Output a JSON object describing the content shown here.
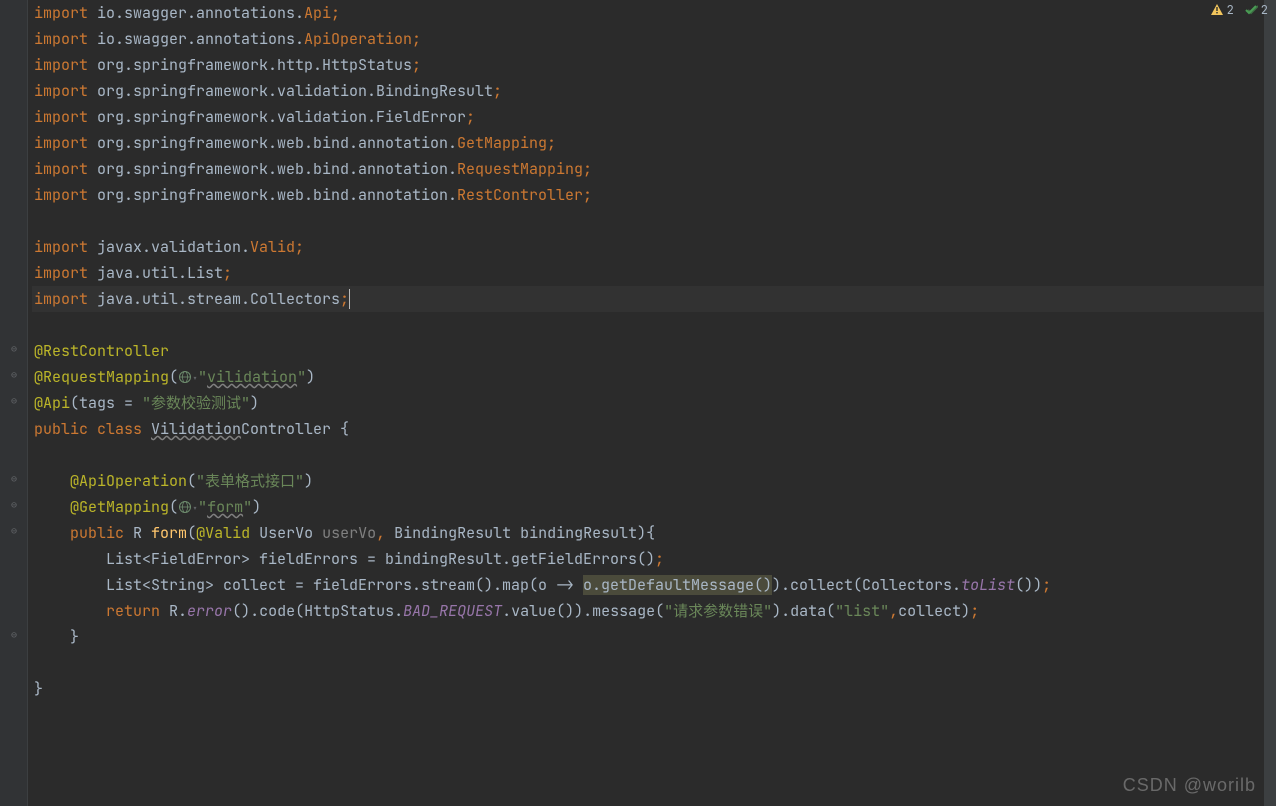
{
  "indicators": {
    "warning_count": "2",
    "check_count": "2"
  },
  "watermark": "CSDN @worilb",
  "code": {
    "lines": [
      {
        "type": "import",
        "parts": [
          {
            "k": "kw",
            "t": "import "
          },
          {
            "k": "p",
            "t": "io.swagger.annotations."
          },
          {
            "k": "cls",
            "t": "Api"
          },
          {
            "k": "semi",
            "t": ";"
          }
        ]
      },
      {
        "type": "import",
        "parts": [
          {
            "k": "kw",
            "t": "import "
          },
          {
            "k": "p",
            "t": "io.swagger.annotations."
          },
          {
            "k": "cls",
            "t": "ApiOperation"
          },
          {
            "k": "semi",
            "t": ";"
          }
        ]
      },
      {
        "type": "import",
        "parts": [
          {
            "k": "kw",
            "t": "import "
          },
          {
            "k": "p",
            "t": "org.springframework.http.HttpStatus"
          },
          {
            "k": "semi",
            "t": ";"
          }
        ]
      },
      {
        "type": "import",
        "parts": [
          {
            "k": "kw",
            "t": "import "
          },
          {
            "k": "p",
            "t": "org.springframework.validation.BindingResult"
          },
          {
            "k": "semi",
            "t": ";"
          }
        ]
      },
      {
        "type": "import",
        "parts": [
          {
            "k": "kw",
            "t": "import "
          },
          {
            "k": "p",
            "t": "org.springframework.validation.FieldError"
          },
          {
            "k": "semi",
            "t": ";"
          }
        ]
      },
      {
        "type": "import",
        "parts": [
          {
            "k": "kw",
            "t": "import "
          },
          {
            "k": "p",
            "t": "org.springframework.web.bind.annotation."
          },
          {
            "k": "cls",
            "t": "GetMapping"
          },
          {
            "k": "semi",
            "t": ";"
          }
        ]
      },
      {
        "type": "import",
        "parts": [
          {
            "k": "kw",
            "t": "import "
          },
          {
            "k": "p",
            "t": "org.springframework.web.bind.annotation."
          },
          {
            "k": "cls",
            "t": "RequestMapping"
          },
          {
            "k": "semi",
            "t": ";"
          }
        ]
      },
      {
        "type": "import",
        "parts": [
          {
            "k": "kw",
            "t": "import "
          },
          {
            "k": "p",
            "t": "org.springframework.web.bind.annotation."
          },
          {
            "k": "cls",
            "t": "RestController"
          },
          {
            "k": "semi",
            "t": ";"
          }
        ]
      },
      {
        "type": "blank"
      },
      {
        "type": "import",
        "parts": [
          {
            "k": "kw",
            "t": "import "
          },
          {
            "k": "p",
            "t": "javax.validation."
          },
          {
            "k": "cls",
            "t": "Valid"
          },
          {
            "k": "semi",
            "t": ";"
          }
        ]
      },
      {
        "type": "import",
        "parts": [
          {
            "k": "kw",
            "t": "import "
          },
          {
            "k": "p",
            "t": "java.util.List"
          },
          {
            "k": "semi",
            "t": ";"
          }
        ]
      },
      {
        "type": "import",
        "highlighted": true,
        "parts": [
          {
            "k": "kw",
            "t": "import "
          },
          {
            "k": "p",
            "t": "java.util.stream.Collectors"
          },
          {
            "k": "semi",
            "t": ";"
          },
          {
            "k": "cursor",
            "t": ""
          }
        ]
      },
      {
        "type": "blank"
      },
      {
        "type": "anno",
        "parts": [
          {
            "k": "ann",
            "t": "@RestController"
          }
        ]
      },
      {
        "type": "anno",
        "parts": [
          {
            "k": "ann",
            "t": "@RequestMapping"
          },
          {
            "k": "p",
            "t": "("
          },
          {
            "k": "globe",
            "t": ""
          },
          {
            "k": "str",
            "t": "\""
          },
          {
            "k": "strwarn",
            "t": "vilidation"
          },
          {
            "k": "str",
            "t": "\""
          },
          {
            "k": "p",
            "t": ")"
          }
        ]
      },
      {
        "type": "anno",
        "parts": [
          {
            "k": "ann",
            "t": "@Api"
          },
          {
            "k": "p",
            "t": "(tags = "
          },
          {
            "k": "str",
            "t": "\"参数校验测试\""
          },
          {
            "k": "p",
            "t": ")"
          }
        ]
      },
      {
        "type": "classdef",
        "parts": [
          {
            "k": "kw",
            "t": "public class "
          },
          {
            "k": "warn",
            "t": "Vilidation"
          },
          {
            "k": "p",
            "t": "Controller {"
          }
        ]
      },
      {
        "type": "blank"
      },
      {
        "type": "anno",
        "indent": 1,
        "parts": [
          {
            "k": "ann",
            "t": "@ApiOperation"
          },
          {
            "k": "p",
            "t": "("
          },
          {
            "k": "str",
            "t": "\"表单格式接口\""
          },
          {
            "k": "p",
            "t": ")"
          }
        ]
      },
      {
        "type": "anno",
        "indent": 1,
        "parts": [
          {
            "k": "ann",
            "t": "@GetMapping"
          },
          {
            "k": "p",
            "t": "("
          },
          {
            "k": "globe",
            "t": ""
          },
          {
            "k": "str",
            "t": "\""
          },
          {
            "k": "strwarn",
            "t": "form"
          },
          {
            "k": "str",
            "t": "\""
          },
          {
            "k": "p",
            "t": ")"
          }
        ]
      },
      {
        "type": "method",
        "indent": 1,
        "parts": [
          {
            "k": "kw",
            "t": "public "
          },
          {
            "k": "p",
            "t": "R "
          },
          {
            "k": "fn",
            "t": "form"
          },
          {
            "k": "p",
            "t": "("
          },
          {
            "k": "ann",
            "t": "@Valid "
          },
          {
            "k": "p",
            "t": "UserVo "
          },
          {
            "k": "var",
            "t": "userVo"
          },
          {
            "k": "semi",
            "t": ", "
          },
          {
            "k": "p",
            "t": "BindingResult bindingResult){"
          }
        ]
      },
      {
        "type": "body",
        "indent": 2,
        "parts": [
          {
            "k": "p",
            "t": "List<FieldError> fieldErrors = bindingResult.getFieldErrors()"
          },
          {
            "k": "semi",
            "t": ";"
          }
        ]
      },
      {
        "type": "body",
        "indent": 2,
        "parts": [
          {
            "k": "p",
            "t": "List<String> collect = fieldErrors.stream().map(o -> "
          },
          {
            "k": "hl",
            "t": "o.getDefaultMessage()"
          },
          {
            "k": "p",
            "t": ").collect(Collectors."
          },
          {
            "k": "ital",
            "t": "toList"
          },
          {
            "k": "p",
            "t": "())"
          },
          {
            "k": "semi",
            "t": ";"
          }
        ]
      },
      {
        "type": "return",
        "indent": 2,
        "parts": [
          {
            "k": "kw",
            "t": "return "
          },
          {
            "k": "p",
            "t": "R."
          },
          {
            "k": "ital",
            "t": "error"
          },
          {
            "k": "p",
            "t": "().code(HttpStatus."
          },
          {
            "k": "ital",
            "t": "BAD_REQUEST"
          },
          {
            "k": "p",
            "t": ".value()).message("
          },
          {
            "k": "str",
            "t": "\"请求参数错误\""
          },
          {
            "k": "p",
            "t": ").data("
          },
          {
            "k": "str",
            "t": "\"list\""
          },
          {
            "k": "semi",
            "t": ","
          },
          {
            "k": "p",
            "t": "collect)"
          },
          {
            "k": "semi",
            "t": ";"
          }
        ]
      },
      {
        "type": "close",
        "indent": 1,
        "parts": [
          {
            "k": "p",
            "t": "}"
          }
        ]
      },
      {
        "type": "blank"
      },
      {
        "type": "close",
        "parts": [
          {
            "k": "p",
            "t": "}"
          }
        ]
      }
    ]
  }
}
